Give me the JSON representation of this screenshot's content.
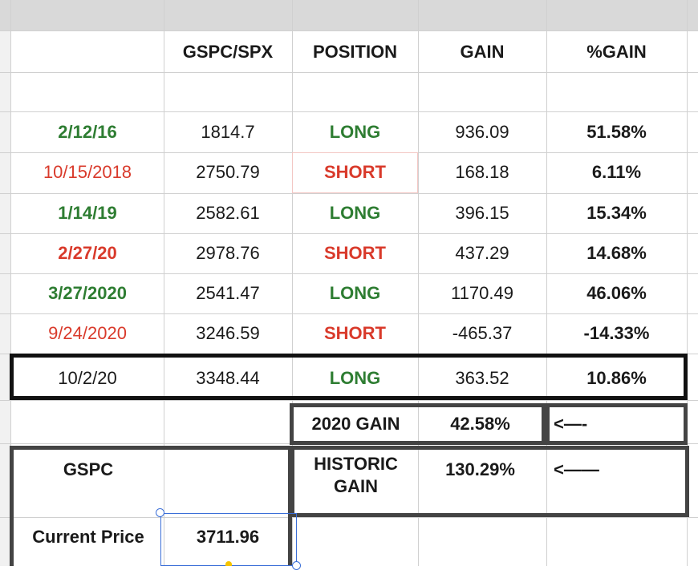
{
  "table": {
    "headers": [
      "GSPC/SPX",
      "POSITION",
      "GAIN",
      "%GAIN"
    ],
    "rows": [
      {
        "date": "2/12/16",
        "price": "1814.7",
        "position": "LONG",
        "gain": "936.09",
        "pct": "51.58%",
        "date_color": "green",
        "date_bold": true
      },
      {
        "date": "10/15/2018",
        "price": "2750.79",
        "position": "SHORT",
        "gain": "168.18",
        "pct": "6.11%",
        "date_color": "red",
        "date_bold": false
      },
      {
        "date": "1/14/19",
        "price": "2582.61",
        "position": "LONG",
        "gain": "396.15",
        "pct": "15.34%",
        "date_color": "green",
        "date_bold": true
      },
      {
        "date": "2/27/20",
        "price": "2978.76",
        "position": "SHORT",
        "gain": "437.29",
        "pct": "14.68%",
        "date_color": "red",
        "date_bold": true
      },
      {
        "date": "3/27/2020",
        "price": "2541.47",
        "position": "LONG",
        "gain": "1170.49",
        "pct": "46.06%",
        "date_color": "green",
        "date_bold": true
      },
      {
        "date": "9/24/2020",
        "price": "3246.59",
        "position": "SHORT",
        "gain": "-465.37",
        "pct": "-14.33%",
        "date_color": "red",
        "date_bold": false
      },
      {
        "date": "10/2/20",
        "price": "3348.44",
        "position": "LONG",
        "gain": "363.52",
        "pct": "10.86%",
        "date_color": "dark",
        "date_bold": false
      }
    ]
  },
  "summary": {
    "gain_2020_label": "2020 GAIN",
    "gain_2020_value": "42.58%",
    "gain_2020_arrow": "<—-",
    "historic_label_line1": "HISTORIC",
    "historic_label_line2": "GAIN",
    "historic_value": "130.29%",
    "historic_arrow": "<——",
    "ticker_label": "GSPC",
    "current_price_label": "Current Price",
    "current_price_value": "3711.96"
  },
  "colors": {
    "long_green": "#2e7d32",
    "short_red": "#d93a2b",
    "grid": "#d0d0d0",
    "header_gray": "#d9d9d9",
    "selection_blue": "#3b6fd8"
  }
}
